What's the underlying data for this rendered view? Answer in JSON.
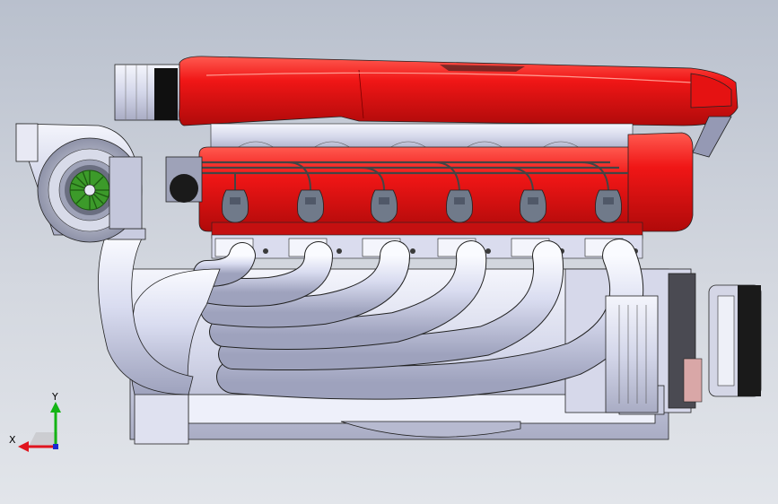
{
  "viewport": {
    "background_top": "#b9c0cd",
    "background_bottom": "#e2e5ea"
  },
  "model": {
    "body_color": "#e0e2f2",
    "cover_color": "#f01616",
    "edge_color": "#222222",
    "rotor_color": "#3c9a2a",
    "coil_color": "#707a8a"
  },
  "triad": {
    "x_label": "X",
    "y_label": "Y",
    "x_color": "#e0141e",
    "y_color": "#14b414",
    "z_color": "#1a2ad0"
  }
}
